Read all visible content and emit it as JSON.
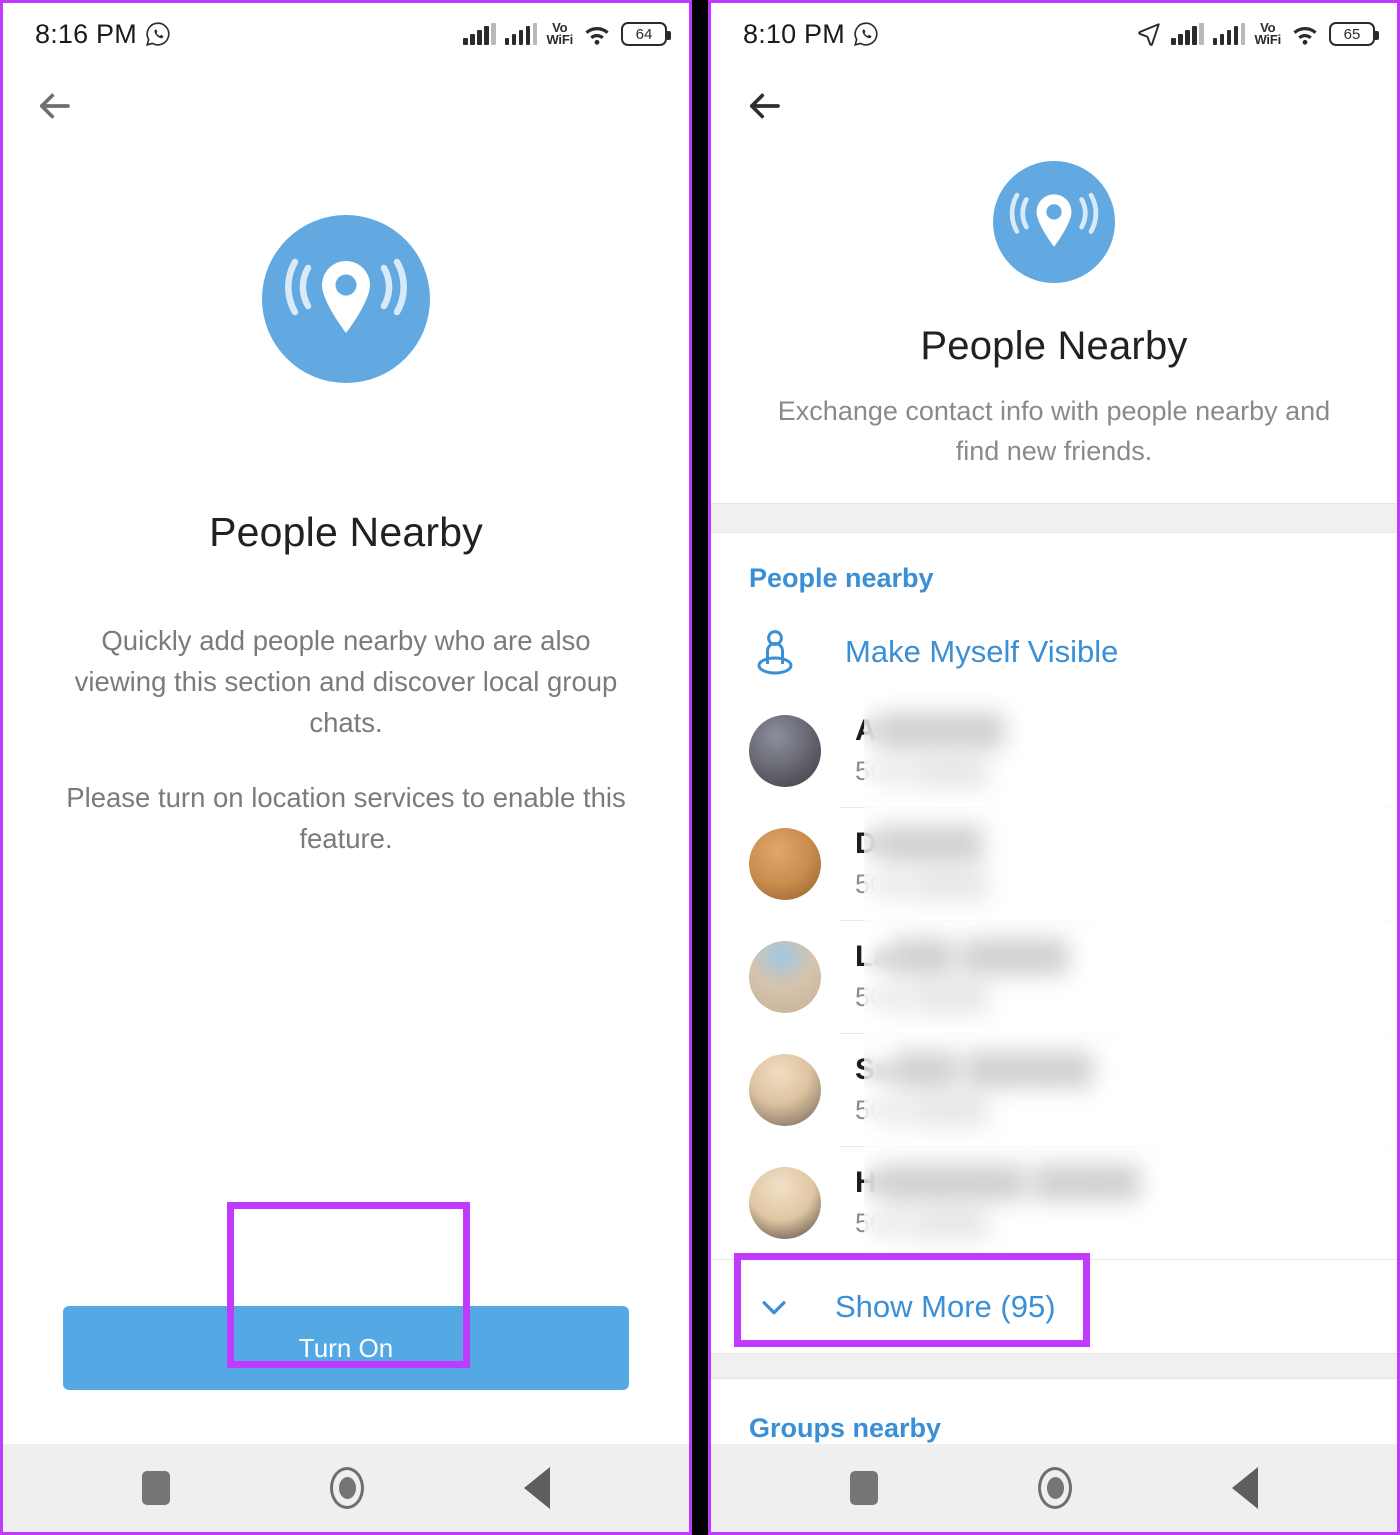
{
  "left_panel": {
    "status_bar": {
      "time": "8:16 PM",
      "whatsapp_icon": "whatsapp-icon",
      "signal_icon_1": "signal-bars-icon",
      "signal_icon_2": "signal-bars-icon",
      "vowifi_top": "Vo",
      "vowifi_bottom": "WiFi",
      "wifi_icon": "wifi-icon",
      "battery_level": "64"
    },
    "back_label": "back-arrow-icon",
    "logo": "people-nearby-logo",
    "title": "People Nearby",
    "description_1": "Quickly add people nearby who are also viewing this section and discover local group chats.",
    "description_2": "Please turn on location services to enable this feature.",
    "turn_on_button": "Turn On"
  },
  "right_panel": {
    "status_bar": {
      "time": "8:10 PM",
      "whatsapp_icon": "whatsapp-icon",
      "location_icon": "location-arrow-icon",
      "signal_icon_1": "signal-bars-icon",
      "signal_icon_2": "signal-bars-icon",
      "vowifi_top": "Vo",
      "vowifi_bottom": "WiFi",
      "wifi_icon": "wifi-icon",
      "battery_level": "65"
    },
    "back_label": "back-arrow-icon",
    "logo": "people-nearby-logo",
    "title": "People Nearby",
    "description": "Exchange contact info with people nearby and find new friends.",
    "people_section_header": "People nearby",
    "make_visible_label": "Make Myself Visible",
    "make_visible_icon": "person-visibility-icon",
    "people": [
      {
        "name": "A",
        "name_blurred": "██████",
        "distance": "50",
        "distance_blurred": "█ ████"
      },
      {
        "name": "D",
        "name_blurred": "█████",
        "distance": "50",
        "distance_blurred": "█ ████"
      },
      {
        "name": "La",
        "name_blurred": "███ █████",
        "distance": "50",
        "distance_blurred": "█ ████"
      },
      {
        "name": "Su",
        "name_blurred": "███ ██████",
        "distance": "50",
        "distance_blurred": "█ ████"
      },
      {
        "name": "H",
        "name_blurred": "███████ █████",
        "distance": "50",
        "distance_blurred": "█ ████"
      }
    ],
    "show_more_label": "Show More (95)",
    "show_more_icon": "chevron-down-icon",
    "groups_section_header": "Groups nearby"
  },
  "nav_bar": {
    "recents_icon": "square-recents-icon",
    "home_icon": "circle-home-icon",
    "back_icon": "triangle-back-icon"
  },
  "colors": {
    "accent_blue": "#54a9e4",
    "link_blue": "#3b8fd4",
    "highlight_purple": "#c13bff",
    "muted_text": "#8a8a8a"
  }
}
